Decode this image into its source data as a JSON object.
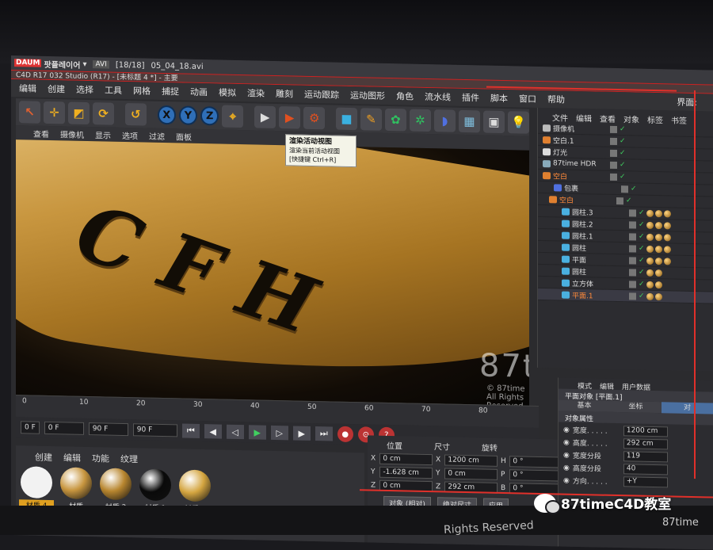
{
  "player": {
    "logo": "DAUM",
    "app": "팟플레이어",
    "format": "AVI",
    "counter": "[18/18]",
    "file": "05_04_18.avi"
  },
  "c4d": {
    "title": "C4D R17 032 Studio (R17) - [未标题 4 *] - 主要",
    "menu": [
      "编辑",
      "创建",
      "选择",
      "工具",
      "网格",
      "捕捉",
      "动画",
      "模拟",
      "渲染",
      "雕刻",
      "运动跟踪",
      "运动图形",
      "角色",
      "流水线",
      "插件",
      "脚本",
      "窗口",
      "帮助"
    ],
    "menu_right": "界面:",
    "axes": [
      "X",
      "Y",
      "Z"
    ],
    "tooltip": {
      "title": "渲染活动视图",
      "desc": "渲染当前活动视图",
      "shortcut": "[快捷键 Ctrl+R]"
    },
    "viewport_menu": [
      "查看",
      "摄像机",
      "显示",
      "选项",
      "过滤",
      "面板"
    ],
    "scene_text": "CFH",
    "watermark": {
      "brand": "87time",
      "rights": "© 87time All Rights Reserved"
    },
    "timeline": {
      "ticks": [
        "0",
        "10",
        "20",
        "30",
        "40",
        "50",
        "60",
        "70",
        "80"
      ],
      "start": "0 F",
      "range_start": "0 F",
      "range_end": "90 F",
      "end": "90 F"
    },
    "materials": {
      "tabs": [
        "创建",
        "编辑",
        "功能",
        "纹理"
      ],
      "items": [
        {
          "label": "材质.4",
          "color": "#f2f2f2"
        },
        {
          "label": "材质",
          "color": "#c8963f"
        },
        {
          "label": "材质.2",
          "color": "#b8862f"
        },
        {
          "label": "材质.1",
          "color": "#0a0a0a"
        },
        {
          "label": "材质.3",
          "color": "#d4a540"
        }
      ]
    },
    "coords": {
      "headers": [
        "位置",
        "尺寸",
        "旋转"
      ],
      "rows": [
        {
          "axis": "X",
          "pos": "0 cm",
          "size": "1200 cm",
          "rot_axis": "H",
          "rot": "0 °"
        },
        {
          "axis": "Y",
          "pos": "-1.628 cm",
          "size": "0 cm",
          "rot_axis": "P",
          "rot": "0 °"
        },
        {
          "axis": "Z",
          "pos": "0 cm",
          "size": "292 cm",
          "rot_axis": "B",
          "rot": "0 °"
        }
      ],
      "mode": "对象 (相对)",
      "size_mode": "绝对尺寸",
      "apply": "应用"
    },
    "objects": {
      "menu": [
        "文件",
        "编辑",
        "查看",
        "对象",
        "标签",
        "书签"
      ],
      "items": [
        {
          "name": "摄像机",
          "kind": "camera",
          "hl": false,
          "sel": false,
          "tags": 0
        },
        {
          "name": "空白.1",
          "kind": "null",
          "hl": false,
          "sel": false,
          "tags": 0
        },
        {
          "name": "灯光",
          "kind": "light",
          "hl": false,
          "sel": false,
          "tags": 0
        },
        {
          "name": "87time HDR",
          "kind": "sky",
          "hl": false,
          "sel": false,
          "tags": 0
        },
        {
          "name": "空白",
          "kind": "null",
          "hl": true,
          "sel": false,
          "tags": 0
        },
        {
          "name": "包裹",
          "kind": "deformer",
          "hl": false,
          "sel": false,
          "tags": 0
        },
        {
          "name": "空白",
          "kind": "null",
          "hl": true,
          "sel": false,
          "tags": 0
        },
        {
          "name": "圆柱.3",
          "kind": "cyl",
          "hl": false,
          "sel": false,
          "tags": 3
        },
        {
          "name": "圆柱.2",
          "kind": "cyl",
          "hl": false,
          "sel": false,
          "tags": 3
        },
        {
          "name": "圆柱.1",
          "kind": "cyl",
          "hl": false,
          "sel": false,
          "tags": 3
        },
        {
          "name": "圆柱",
          "kind": "cyl",
          "hl": false,
          "sel": false,
          "tags": 3
        },
        {
          "name": "平面",
          "kind": "plane",
          "hl": false,
          "sel": false,
          "tags": 3
        },
        {
          "name": "圆柱",
          "kind": "cyl",
          "hl": false,
          "sel": false,
          "tags": 2
        },
        {
          "name": "立方体",
          "kind": "cube",
          "hl": false,
          "sel": false,
          "tags": 2
        },
        {
          "name": "平面.1",
          "kind": "plane",
          "hl": true,
          "sel": true,
          "tags": 2
        }
      ]
    },
    "attributes": {
      "tabs": [
        "模式",
        "编辑",
        "用户数据"
      ],
      "header": "平面对象 [平面.1]",
      "subtabs": [
        "基本",
        "坐标",
        "对"
      ],
      "section": "对象属性",
      "props": [
        {
          "label": "宽度. . . . .",
          "value": "1200 cm"
        },
        {
          "label": "高度. . . . .",
          "value": "292 cm"
        },
        {
          "label": "宽度分段",
          "value": "119"
        },
        {
          "label": "高度分段",
          "value": "40"
        },
        {
          "label": "方向. . . . .",
          "value": "+Y"
        }
      ]
    }
  },
  "footer": {
    "rights": "Rights Reserved",
    "brand": "87time"
  },
  "wechat": "87timeC4D教室"
}
